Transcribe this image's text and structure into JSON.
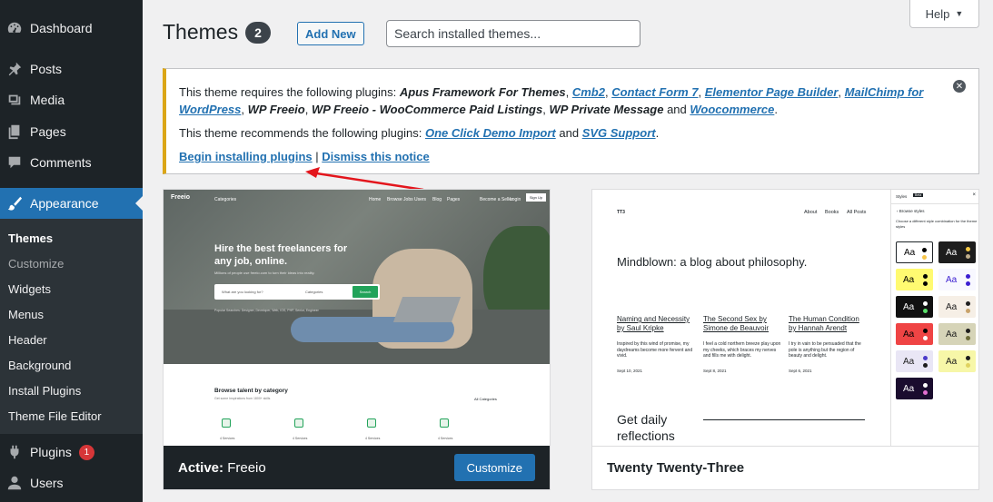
{
  "sidebar": {
    "items": [
      {
        "label": "Dashboard",
        "icon": "dashboard-icon"
      },
      {
        "label": "Posts",
        "icon": "pin-icon"
      },
      {
        "label": "Media",
        "icon": "media-icon"
      },
      {
        "label": "Pages",
        "icon": "pages-icon"
      },
      {
        "label": "Comments",
        "icon": "comment-icon"
      },
      {
        "label": "Appearance",
        "icon": "brush-icon"
      },
      {
        "label": "Plugins",
        "icon": "plug-icon",
        "badge": "1"
      },
      {
        "label": "Users",
        "icon": "user-icon"
      }
    ],
    "submenu": [
      "Themes",
      "Customize",
      "Widgets",
      "Menus",
      "Header",
      "Background",
      "Install Plugins",
      "Theme File Editor"
    ],
    "colors": {
      "bg": "#1d2327",
      "active": "#2271b1",
      "badge": "#d63638"
    }
  },
  "header": {
    "title": "Themes",
    "count": "2",
    "add_new": "Add New",
    "search_placeholder": "Search installed themes...",
    "help": "Help"
  },
  "notice": {
    "line1_prefix": "This theme requires the following plugins:",
    "req_plain_1": "Apus Framework For Themes",
    "req_link_1": "Cmb2",
    "req_link_2": "Contact Form 7",
    "req_link_3": "Elementor Page Builder",
    "req_link_4": "MailChimp for WordPress",
    "req_plain_2": "WP Freeio",
    "req_plain_3": "WP Freeio - WooCommerce Paid Listings",
    "req_plain_4": "WP Private Message",
    "and": "and",
    "req_link_5": "Woocommerce",
    "line2_prefix": "This theme recommends the following plugins:",
    "rec_link_1": "One Click Demo Import",
    "rec_link_2": "SVG Support",
    "begin": "Begin installing plugins",
    "separator": "|",
    "dismiss": "Dismiss this notice",
    "accent": "#dba617"
  },
  "themes": [
    {
      "footer_prefix": "Active:",
      "name": "Freeio",
      "action": "Customize",
      "preview": {
        "logo": "Freeio",
        "nav_categories": "Categories",
        "nav": [
          "Home",
          "Browse Jobs",
          "Users",
          "Blog",
          "Pages"
        ],
        "become_seller": "Become a Seller",
        "login": "Login",
        "signup": "Sign Up",
        "headline": "Hire the best freelancers for any job, online.",
        "sub": "Millions of people use freeio.com to turn their ideas into reality.",
        "search_placeholder": "What are you looking for?",
        "search_category": "Categories",
        "search_button": "Search",
        "popular": "Popular Searches: Designer, Developer, Web, IOS, PHP, Senior, Engineer",
        "browse_title": "Browse talent by category",
        "browse_sub": "Get some Inspirations from 1800+ skills",
        "all_categories": "All Categories",
        "category_label": "4 Services"
      }
    },
    {
      "name": "Twenty Twenty-Three",
      "preview": {
        "logo": "TT3",
        "nav": [
          "About",
          "Books",
          "All Posts"
        ],
        "headline": "Mindblown: a blog about philosophy.",
        "posts": [
          {
            "title": "Naming and Necessity by Saul Kripke",
            "excerpt": "Inspired by this wind of promise, my daydreams become more fervent and vivid.",
            "date": "Sept 10, 2021"
          },
          {
            "title": "The Second Sex by Simone de Beauvoir",
            "excerpt": "I feel a cold northern breeze play upon my cheeks, which braces my nerves and fills me with delight.",
            "date": "Sept 8, 2021"
          },
          {
            "title": "The Human Condition by Hannah Arendt",
            "excerpt": "I try in vain to be persuaded that the pole is anything but the region of beauty and delight.",
            "date": "Sept 6, 2021"
          }
        ],
        "daily": "Get daily reflections",
        "panel_title": "Styles",
        "panel_badge": "Beta",
        "panel_close": "×",
        "panel_back": "Browse styles",
        "panel_hint": "Choose a different style combination for the theme styles",
        "swatch_label": "Aa",
        "swatches": [
          {
            "bg": "#ffffff",
            "fg": "#000000",
            "dot1": "#000000",
            "dot2": "#f7c54a"
          },
          {
            "bg": "#1d1d1d",
            "fg": "#ffffff",
            "dot1": "#f5c944",
            "dot2": "#bfae8b"
          },
          {
            "bg": "#fffa71",
            "fg": "#000000",
            "dot1": "#000000",
            "dot2": "#000000"
          },
          {
            "bg": "#f8f8ff",
            "fg": "#3c1fd1",
            "dot1": "#3c1fd1",
            "dot2": "#3c1fd1"
          },
          {
            "bg": "#111111",
            "fg": "#ffffff",
            "dot1": "#ffffff",
            "dot2": "#59e06a"
          },
          {
            "bg": "#f6efe6",
            "fg": "#202020",
            "dot1": "#202020",
            "dot2": "#c9a36b"
          },
          {
            "bg": "#ef4444",
            "fg": "#000000",
            "dot1": "#000000",
            "dot2": "#ffffff"
          },
          {
            "bg": "#d6d4b8",
            "fg": "#1d1d1d",
            "dot1": "#1d1d1d",
            "dot2": "#6b6b38"
          },
          {
            "bg": "#e9e6f5",
            "fg": "#1d1d1d",
            "dot1": "#4b3bcb",
            "dot2": "#1d1d1d"
          },
          {
            "bg": "#f7f7a8",
            "fg": "#1d1d1d",
            "dot1": "#1d1d1d",
            "dot2": "#e0d35f"
          },
          {
            "bg": "#1a0c2e",
            "fg": "#ffffff",
            "dot1": "#ffffff",
            "dot2": "#e26fd0"
          }
        ]
      }
    }
  ]
}
